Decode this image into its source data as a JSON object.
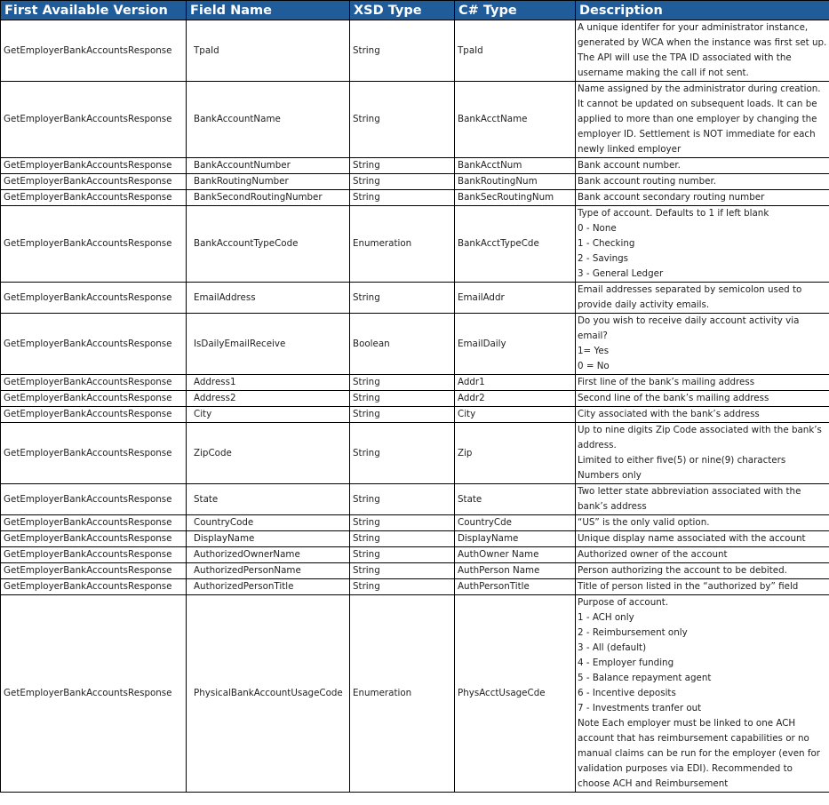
{
  "table": {
    "headers": [
      "First Available Version",
      "Field Name",
      "XSD Type",
      "C# Type",
      "Description"
    ],
    "rows": [
      {
        "version": "GetEmployerBankAccountsResponse",
        "field": "TpaId",
        "xsd": "String",
        "csharp": "TpaId",
        "description": [
          "A unique identifer for your administrator instance,",
          "generated by WCA when the instance was first set up.",
          "The API will use the TPA ID associated with the",
          "username making the call if not sent."
        ]
      },
      {
        "version": "GetEmployerBankAccountsResponse",
        "field": "BankAccountName",
        "xsd": "String",
        "csharp": "BankAcctName",
        "description": [
          "Name assigned by the administrator during creation.",
          "It cannot be updated on subsequent loads. It can be",
          "applied to more than one employer by changing the",
          "employer ID. Settlement is NOT immediate for each",
          "newly linked employer"
        ]
      },
      {
        "version": "GetEmployerBankAccountsResponse",
        "field": "BankAccountNumber",
        "xsd": "String",
        "csharp": "BankAcctNum",
        "description": [
          "Bank account number."
        ]
      },
      {
        "version": "GetEmployerBankAccountsResponse",
        "field": "BankRoutingNumber",
        "xsd": "String",
        "csharp": "BankRoutingNum",
        "description": [
          "Bank account routing number."
        ]
      },
      {
        "version": "GetEmployerBankAccountsResponse",
        "field": "BankSecondRoutingNumber",
        "xsd": "String",
        "csharp": "BankSecRoutingNum",
        "description": [
          " Bank account secondary routing number"
        ]
      },
      {
        "version": "GetEmployerBankAccountsResponse",
        "field": "BankAccountTypeCode",
        "xsd": "Enumeration",
        "csharp": "BankAcctTypeCde",
        "description": [
          "Type of account. Defaults to 1 if left blank",
          "0 - None",
          "1 - Checking",
          "2 - Savings",
          "3 - General Ledger"
        ]
      },
      {
        "version": "GetEmployerBankAccountsResponse",
        "field": "EmailAddress",
        "xsd": "String",
        "csharp": "EmailAddr",
        "description": [
          "Email addresses separated by semicolon used to",
          "provide daily activity emails."
        ]
      },
      {
        "version": "GetEmployerBankAccountsResponse",
        "field": "IsDailyEmailReceive",
        "xsd": "Boolean",
        "csharp": "EmailDaily",
        "description": [
          "Do you wish to receive daily account activity via",
          "email?",
          "1= Yes",
          "0 = No"
        ]
      },
      {
        "version": "GetEmployerBankAccountsResponse",
        "field": "Address1",
        "xsd": "String",
        "csharp": "Addr1",
        "description": [
          "First line of the bank’s mailing address"
        ]
      },
      {
        "version": "GetEmployerBankAccountsResponse",
        "field": "Address2",
        "xsd": "String",
        "csharp": "Addr2",
        "description": [
          "Second line of the bank’s mailing address"
        ]
      },
      {
        "version": "GetEmployerBankAccountsResponse",
        "field": "City",
        "xsd": "String",
        "csharp": "City",
        "description": [
          "City associated with the bank’s address"
        ]
      },
      {
        "version": "GetEmployerBankAccountsResponse",
        "field": "ZipCode",
        "xsd": "String",
        "csharp": "Zip",
        "description": [
          "Up to nine digits Zip Code associated with the bank’s",
          "address.",
          "Limited to either five(5) or nine(9) characters",
          "Numbers only"
        ]
      },
      {
        "version": "GetEmployerBankAccountsResponse",
        "field": "State",
        "xsd": "String",
        "csharp": "State",
        "description": [
          "Two letter state abbreviation associated with the",
          "bank’s address"
        ]
      },
      {
        "version": "GetEmployerBankAccountsResponse",
        "field": "CountryCode",
        "xsd": "String",
        "csharp": "CountryCde",
        "description": [
          "“US” is the only valid option."
        ]
      },
      {
        "version": "GetEmployerBankAccountsResponse",
        "field": "DisplayName",
        "xsd": "String",
        "csharp": "DisplayName",
        "description": [
          "Unique display name associated with the account"
        ]
      },
      {
        "version": "GetEmployerBankAccountsResponse",
        "field": "AuthorizedOwnerName",
        "xsd": "String",
        "csharp": "AuthOwner Name",
        "description": [
          "Authorized owner of the account"
        ]
      },
      {
        "version": "GetEmployerBankAccountsResponse",
        "field": "AuthorizedPersonName",
        "xsd": "String",
        "csharp": "AuthPerson Name",
        "description": [
          "Person authorizing the account to be debited."
        ]
      },
      {
        "version": "GetEmployerBankAccountsResponse",
        "field": "AuthorizedPersonTitle",
        "xsd": "String",
        "csharp": "AuthPersonTitle",
        "description": [
          "Title of person listed in the “authorized by” field"
        ]
      },
      {
        "version": "GetEmployerBankAccountsResponse",
        "field": "PhysicalBankAccountUsageCode",
        "xsd": "Enumeration",
        "csharp": "PhysAcctUsageCde",
        "description": [
          "Purpose of account.",
          "1 - ACH only",
          "2 - Reimbursement only",
          "3 - All (default)",
          "4 - Employer funding",
          "5 - Balance repayment agent",
          "6 - Incentive deposits",
          "7 - Investments tranfer out",
          "Note Each employer must be linked to one ACH",
          "account that has reimbursement capabilities or no",
          "manual claims can be run for the employer (even for",
          "validation purposes via EDI). Recommended to",
          "choose ACH and Reimbursement"
        ]
      }
    ]
  }
}
